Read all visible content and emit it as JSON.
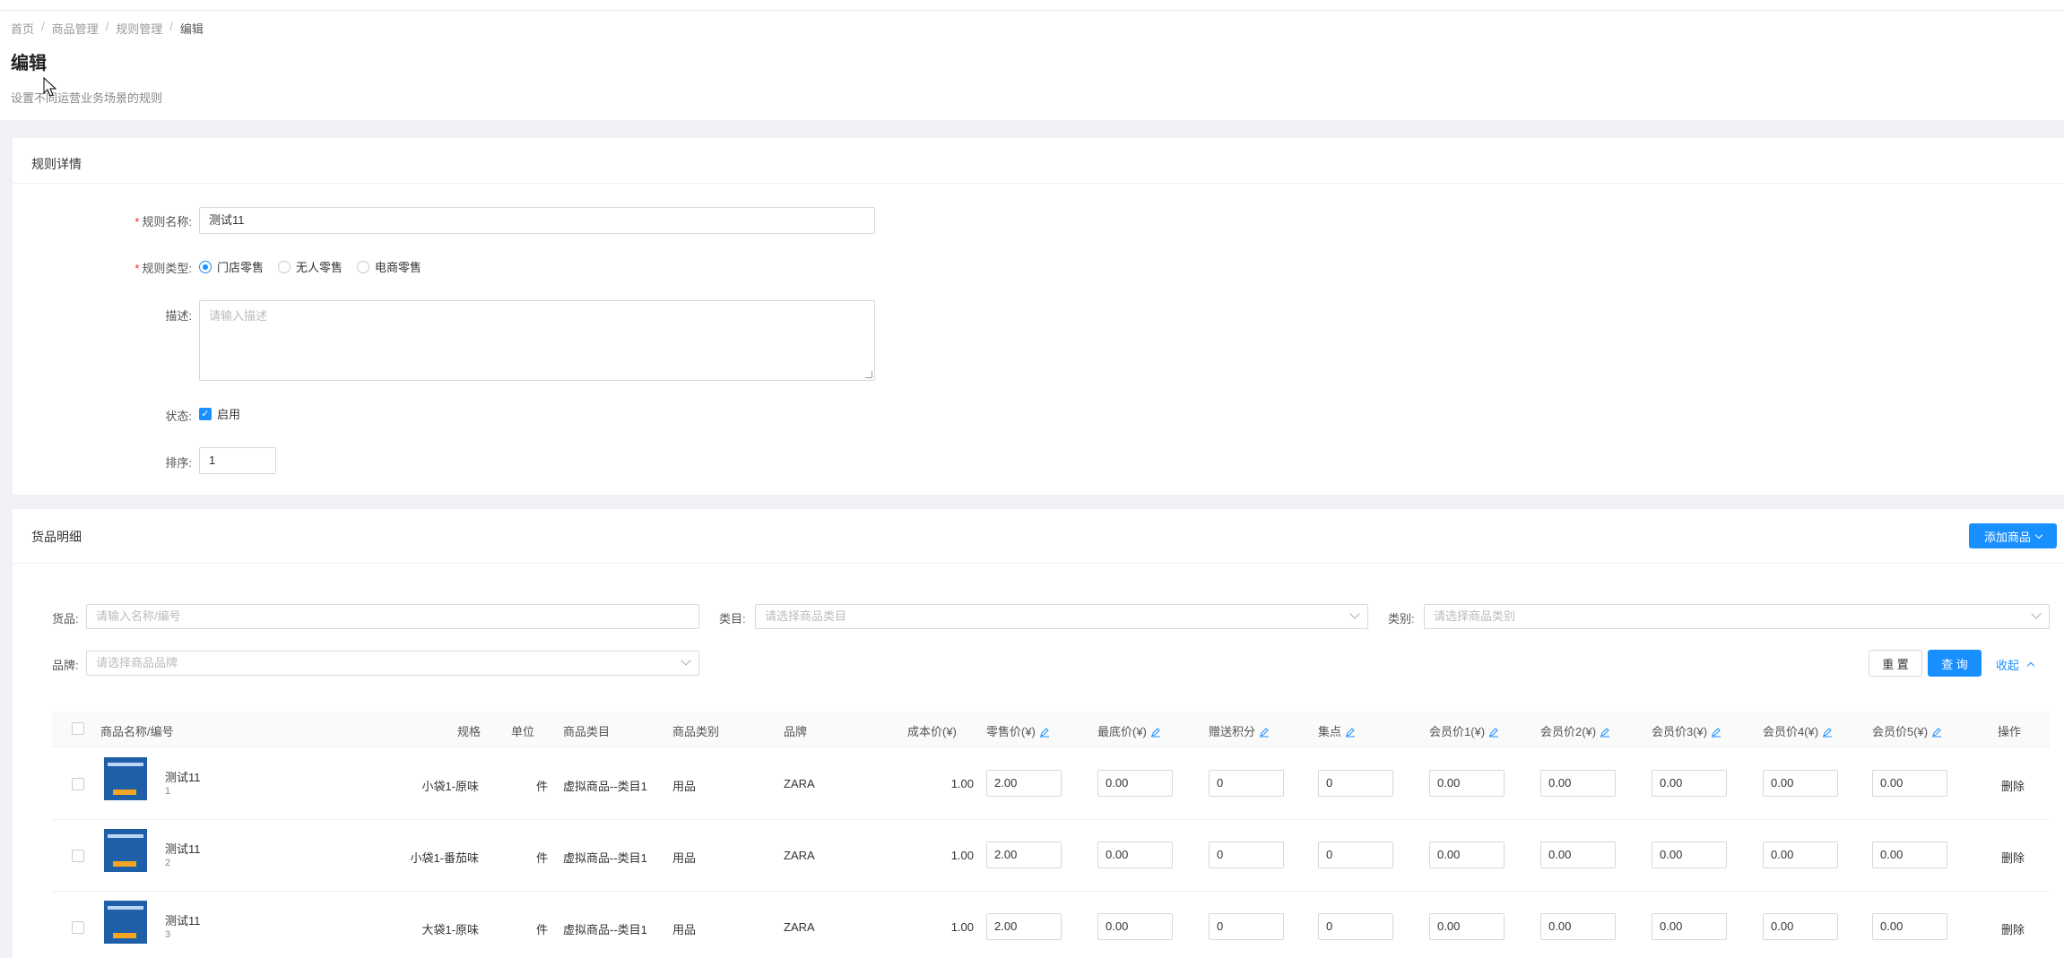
{
  "breadcrumb": [
    "首页",
    "商品管理",
    "规则管理",
    "编辑"
  ],
  "page": {
    "title": "编辑",
    "description": "设置不同运营业务场景的规则"
  },
  "rule_detail": {
    "section_title": "规则详情",
    "name_label": "规则名称:",
    "name_value": "测试11",
    "type_label": "规则类型:",
    "type_options": [
      "门店零售",
      "无人零售",
      "电商零售"
    ],
    "type_selected": "门店零售",
    "desc_label": "描述:",
    "desc_placeholder": "请输入描述",
    "status_label": "状态:",
    "status_checkbox_label": "启用",
    "status_checked": true,
    "sort_label": "排序:",
    "sort_value": "1"
  },
  "goods": {
    "section_title": "货品明细",
    "add_button": "添加商品",
    "filters": {
      "goods_label": "货品:",
      "goods_placeholder": "请输入名称/编号",
      "category_label": "类目:",
      "category_placeholder": "请选择商品类目",
      "type_label": "类别:",
      "type_placeholder": "请选择商品类别",
      "brand_label": "品牌:",
      "brand_placeholder": "请选择商品品牌",
      "reset_button": "重 置",
      "query_button": "查 询",
      "collapse_link": "收起"
    },
    "columns": {
      "name": "商品名称/编号",
      "spec": "规格",
      "unit": "单位",
      "category": "商品类目",
      "type": "商品类别",
      "brand": "品牌",
      "cost": "成本价(¥)",
      "retail": "零售价(¥)",
      "min": "最底价(¥)",
      "points": "赠送积分",
      "stamps": "集点",
      "member1": "会员价1(¥)",
      "member2": "会员价2(¥)",
      "member3": "会员价3(¥)",
      "member4": "会员价4(¥)",
      "member5": "会员价5(¥)",
      "action": "操作"
    },
    "rows": [
      {
        "name": "测试11",
        "code": "1",
        "spec": "小袋1-原味",
        "unit": "件",
        "category": "虚拟商品--类目1",
        "type": "用品",
        "brand": "ZARA",
        "cost": "1.00",
        "retail": "2.00",
        "min": "0.00",
        "points": "0",
        "stamps": "0",
        "m1": "0.00",
        "m2": "0.00",
        "m3": "0.00",
        "m4": "0.00",
        "m5": "0.00",
        "action": "删除"
      },
      {
        "name": "测试11",
        "code": "2",
        "spec": "小袋1-番茄味",
        "unit": "件",
        "category": "虚拟商品--类目1",
        "type": "用品",
        "brand": "ZARA",
        "cost": "1.00",
        "retail": "2.00",
        "min": "0.00",
        "points": "0",
        "stamps": "0",
        "m1": "0.00",
        "m2": "0.00",
        "m3": "0.00",
        "m4": "0.00",
        "m5": "0.00",
        "action": "删除"
      },
      {
        "name": "测试11",
        "code": "3",
        "spec": "大袋1-原味",
        "unit": "件",
        "category": "虚拟商品--类目1",
        "type": "用品",
        "brand": "ZARA",
        "cost": "1.00",
        "retail": "2.00",
        "min": "0.00",
        "points": "0",
        "stamps": "0",
        "m1": "0.00",
        "m2": "0.00",
        "m3": "0.00",
        "m4": "0.00",
        "m5": "0.00",
        "action": "删除"
      }
    ]
  },
  "colors": {
    "primary": "#1890ff",
    "required": "#f5222d",
    "background": "#f0f2f5"
  }
}
